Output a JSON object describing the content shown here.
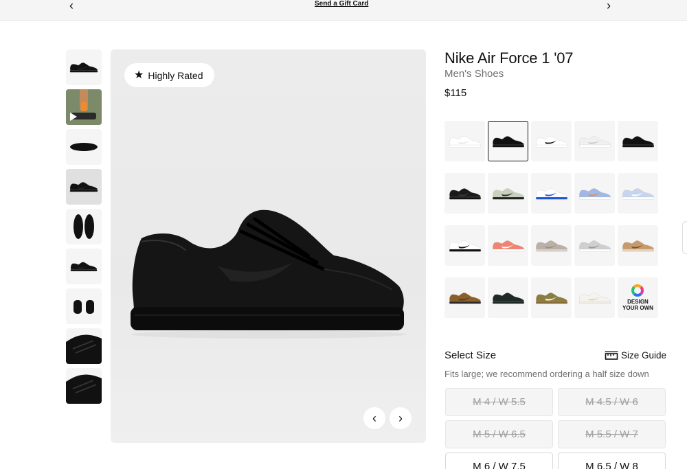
{
  "topbar": {
    "prev_arrow": "‹",
    "next_arrow": "›",
    "gift_link": "Send a Gift Card"
  },
  "badge": {
    "icon": "star-icon",
    "label": "Highly Rated"
  },
  "product": {
    "title": "Nike Air Force 1 '07",
    "subtitle": "Men's Shoes",
    "price": "$115"
  },
  "thumbnails": [
    {
      "shoe": "#111111",
      "view": "side"
    },
    {
      "shoe": "#222222",
      "view": "video"
    },
    {
      "shoe": "#111111",
      "view": "sole"
    },
    {
      "shoe": "#111111",
      "view": "side"
    },
    {
      "shoe": "#111111",
      "view": "top"
    },
    {
      "shoe": "#111111",
      "view": "pair"
    },
    {
      "shoe": "#111111",
      "view": "back"
    },
    {
      "shoe": "#111111",
      "view": "closeup"
    },
    {
      "shoe": "#111111",
      "view": "closeup"
    }
  ],
  "colorways": [
    {
      "body": "#ffffff",
      "accent": "#e6e6e6",
      "sole": "#ffffff"
    },
    {
      "body": "#111111",
      "accent": "#111111",
      "sole": "#111111",
      "selected": true
    },
    {
      "body": "#ffffff",
      "accent": "#111111",
      "sole": "#ffffff"
    },
    {
      "body": "#f0f0f0",
      "accent": "#c8c8c8",
      "sole": "#ffffff"
    },
    {
      "body": "#111111",
      "accent": "#111111",
      "sole": "#111111"
    },
    {
      "body": "#1a1a1a",
      "accent": "#3a3a3a",
      "sole": "#111111"
    },
    {
      "body": "#c9d1bc",
      "accent": "#222222",
      "sole": "#222222"
    },
    {
      "body": "#ffffff",
      "accent": "#1f55d6",
      "sole": "#1f55d6"
    },
    {
      "body": "#9fb8e6",
      "accent": "#f08a43",
      "sole": "#ffffff"
    },
    {
      "body": "#c6d5ee",
      "accent": "#ffffff",
      "sole": "#ffffff"
    },
    {
      "body": "#ffffff",
      "accent": "#111111",
      "sole": "#111111"
    },
    {
      "body": "#f08472",
      "accent": "#ffffff",
      "sole": "#ffffff"
    },
    {
      "body": "#b9b1a6",
      "accent": "#9c9286",
      "sole": "#d8d2c8"
    },
    {
      "body": "#cfcfcf",
      "accent": "#9a9a9a",
      "sole": "#ffffff"
    },
    {
      "body": "#c69a6d",
      "accent": "#7a4f35",
      "sole": "#e6d3bb"
    },
    {
      "body": "#8a5f2a",
      "accent": "#5a3a18",
      "sole": "#2b2b2b"
    },
    {
      "body": "#1f2a26",
      "accent": "#1f2a26",
      "sole": "#1f2a26"
    },
    {
      "body": "#8a7d3e",
      "accent": "#ffffff",
      "sole": "#8a6a3a"
    },
    {
      "body": "#f5f3ee",
      "accent": "#d8d3c7",
      "sole": "#f0ece3"
    },
    {
      "design_your_own": true,
      "line1": "DESIGN",
      "line2": "YOUR OWN"
    }
  ],
  "size_section": {
    "label": "Select Size",
    "guide_label": "Size Guide",
    "guide_icon": "ruler-icon",
    "fit_note": "Fits large; we recommend ordering a half size down",
    "sizes": [
      {
        "label": "M 4 / W 5.5",
        "available": false
      },
      {
        "label": "M 4.5 / W 6",
        "available": false
      },
      {
        "label": "M 5 / W 6.5",
        "available": false
      },
      {
        "label": "M 5.5 / W 7",
        "available": false
      },
      {
        "label": "M 6 / W 7.5",
        "available": true
      },
      {
        "label": "M 6.5 / W 8",
        "available": true
      }
    ]
  },
  "gallery_nav": {
    "prev": "‹",
    "next": "›"
  }
}
